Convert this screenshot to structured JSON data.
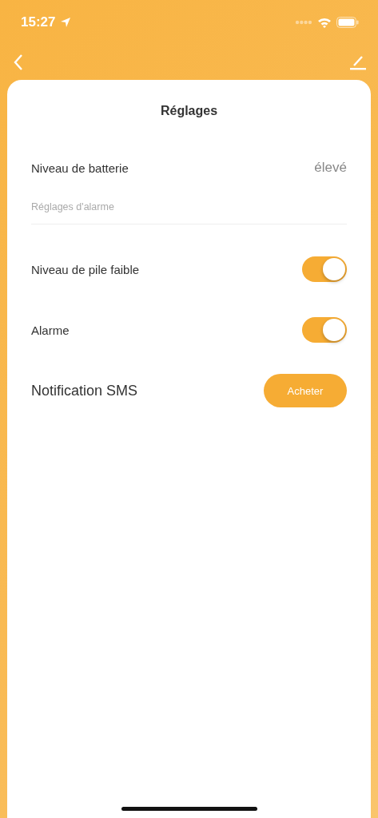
{
  "status_bar": {
    "time": "15:27"
  },
  "card": {
    "title": "Réglages"
  },
  "rows": [
    {
      "kind": "value",
      "label": "Niveau de batterie",
      "value": "élevé"
    },
    {
      "kind": "section",
      "label": "Réglages d'alarme"
    },
    {
      "kind": "toggle",
      "label": "Niveau de pile faible",
      "on": true
    },
    {
      "kind": "toggle",
      "label": "Alarme",
      "on": true
    },
    {
      "kind": "button",
      "label": "Notification SMS",
      "button": "Acheter"
    }
  ]
}
